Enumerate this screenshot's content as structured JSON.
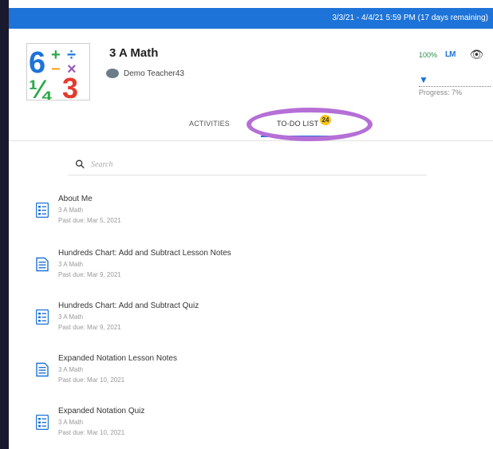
{
  "header": {
    "date_range": "3/3/21 - 4/4/21 5:59 PM (17 days remaining)"
  },
  "course": {
    "title": "3 A Math",
    "teacher": "Demo Teacher43",
    "logo_icon": "math-symbols-logo",
    "logo_text": [
      "6",
      "+",
      "÷",
      "−",
      "×",
      "¼",
      "3"
    ]
  },
  "tools": {
    "percent": "100%",
    "grade_icon": "gradebook-icon",
    "grade_text": "LM",
    "view_icon": "eye-icon"
  },
  "progress": {
    "label": "Progress: 7%",
    "value_percent": 7,
    "icon": "location-pin-icon"
  },
  "tabs": [
    {
      "label": "ACTIVITIES"
    },
    {
      "label": "TO-DO LIST",
      "badge": "24",
      "active": true
    }
  ],
  "search": {
    "placeholder": "Search",
    "icon": "search-icon"
  },
  "todo_items": [
    {
      "title": "About Me",
      "course": "3 A Math",
      "due": "Past due: Mar 5, 2021",
      "icon": "quiz-icon"
    },
    {
      "title": "Hundreds Chart: Add and Subtract Lesson Notes",
      "course": "3 A Math",
      "due": "Past due: Mar 9, 2021",
      "icon": "notes-icon"
    },
    {
      "title": "Hundreds Chart: Add and Subtract Quiz",
      "course": "3 A Math",
      "due": "Past due: Mar 9, 2021",
      "icon": "quiz-icon"
    },
    {
      "title": "Expanded Notation Lesson Notes",
      "course": "3 A Math",
      "due": "Past due: Mar 10, 2021",
      "icon": "notes-icon"
    },
    {
      "title": "Expanded Notation Quiz",
      "course": "3 A Math",
      "due": "Past due: Mar 10, 2021",
      "icon": "quiz-icon"
    }
  ],
  "colors": {
    "header_bar": "#1e73d8",
    "badge": "#f5c518",
    "highlight_ring": "#b56fd6",
    "icon_blue": "#1e73d8"
  }
}
